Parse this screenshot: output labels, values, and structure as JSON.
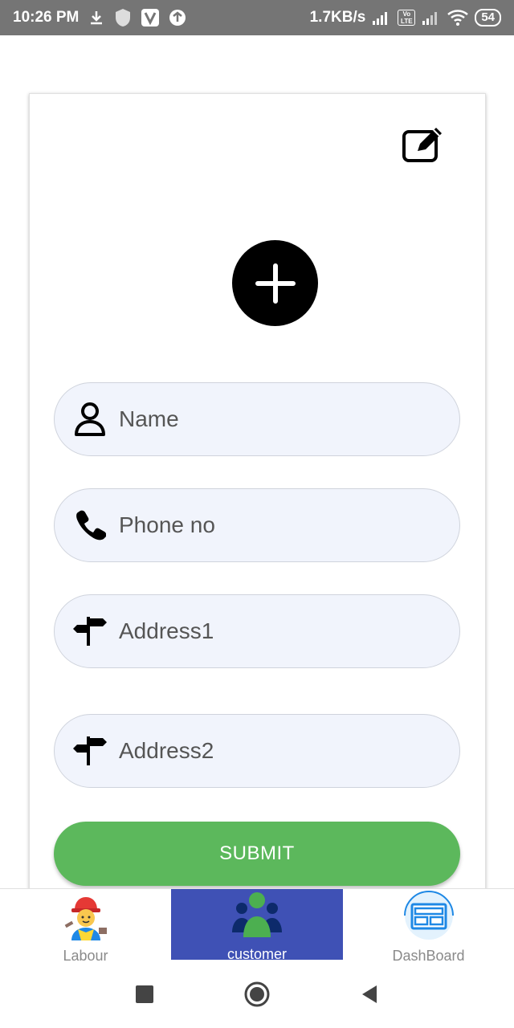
{
  "status_bar": {
    "time": "10:26 PM",
    "net_speed": "1.7KB/s",
    "battery": "54",
    "volte": "Vo LTE"
  },
  "form": {
    "fields": [
      {
        "placeholder": "Name",
        "icon": "person-icon"
      },
      {
        "placeholder": "Phone no",
        "icon": "phone-icon"
      },
      {
        "placeholder": "Address1",
        "icon": "signpost-icon"
      },
      {
        "placeholder": "Address2",
        "icon": "signpost-icon"
      }
    ],
    "submit_label": "SUBMIT"
  },
  "bottom_nav": {
    "items": [
      {
        "label": "Labour",
        "icon": "labour-worker-icon",
        "active": false
      },
      {
        "label": "customer",
        "icon": "customer-group-icon",
        "active": true
      },
      {
        "label": "DashBoard",
        "icon": "dashboard-icon",
        "active": false
      }
    ]
  },
  "colors": {
    "status_bar": "#757575",
    "field_bg": "#f1f4fc",
    "submit": "#5cb85c",
    "nav_active": "#3f51b5"
  }
}
